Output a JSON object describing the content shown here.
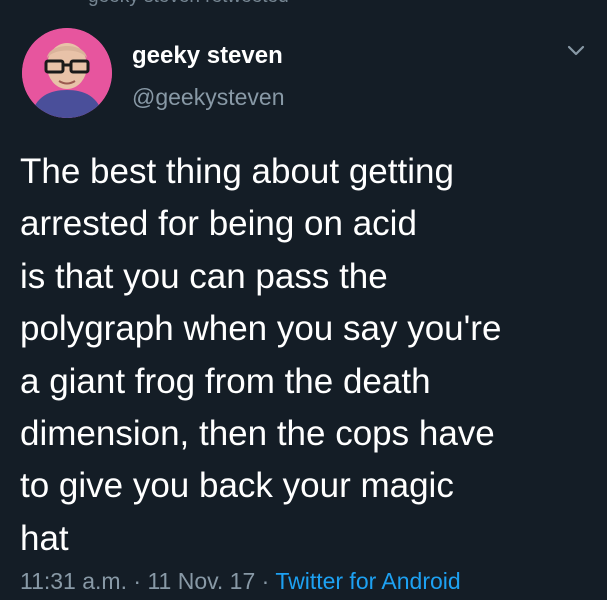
{
  "retweeted_by": "geeky steven retweeted",
  "user": {
    "display_name": "geeky steven",
    "handle": "@geekysteven",
    "avatar_icon": "profile-photo"
  },
  "tweet": {
    "lines": [
      "The best thing about getting",
      "arrested for being on acid",
      "is that you can pass the",
      "polygraph when you say you're",
      "a giant frog from the death",
      "dimension, then the cops have",
      "to give you back your magic",
      "hat"
    ],
    "time": "11:31 a.m.",
    "date": "11 Nov. 17",
    "separator": "·",
    "source": "Twitter for Android"
  },
  "colors": {
    "background": "#141d26",
    "secondary_text": "#8899a6",
    "link": "#1da1f2",
    "avatar_bg": "#e7559e"
  }
}
